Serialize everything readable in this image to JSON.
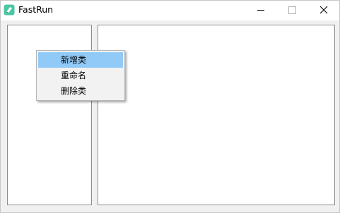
{
  "window": {
    "title": "FastRun",
    "icon": "fastrun-app-icon",
    "controls": {
      "minimize_icon": "minimize-icon",
      "maximize_icon": "maximize-icon",
      "close_icon": "close-icon"
    }
  },
  "context_menu": {
    "items": [
      {
        "label": "新增类",
        "highlighted": true
      },
      {
        "label": "重命名",
        "highlighted": false
      },
      {
        "label": "删除类",
        "highlighted": false
      }
    ]
  },
  "colors": {
    "titlebar_bg": "#ffffff",
    "client_bg": "#f0f0f0",
    "menu_highlight": "#91c9f7",
    "panel_border": "#8c8c8c"
  }
}
